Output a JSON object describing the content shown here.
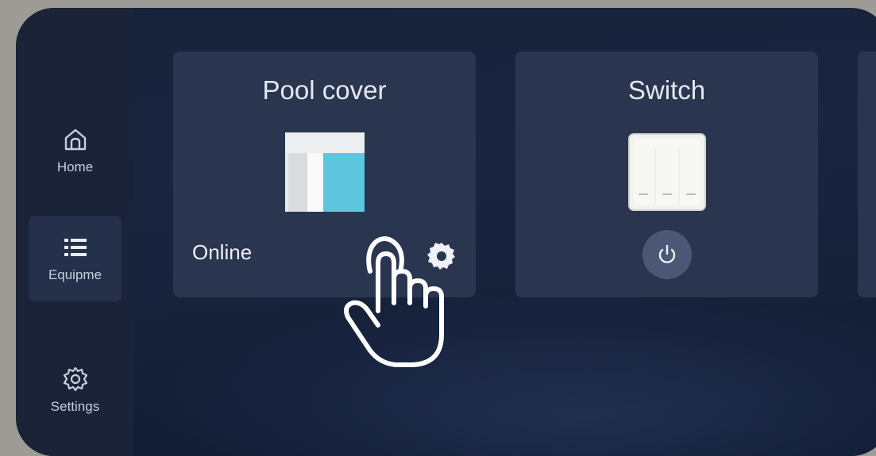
{
  "sidebar": {
    "items": [
      {
        "label": "Home",
        "icon": "home-icon",
        "active": false
      },
      {
        "label": "Equipme",
        "icon": "list-icon",
        "active": true
      },
      {
        "label": "Settings",
        "icon": "gear-icon",
        "active": false
      }
    ]
  },
  "cards": [
    {
      "title": "Pool cover",
      "status": "Online",
      "image": "pool-cover-image",
      "action_icon": "gear-icon"
    },
    {
      "title": "Switch",
      "image": "switch-image",
      "action_icon": "power-icon"
    }
  ],
  "overlay": {
    "icon": "tap-hand-icon"
  },
  "colors": {
    "background": "#17223a",
    "sidebar": "#1a2338",
    "card": "#2a3550",
    "pool_cover_blue": "#5fc7dd",
    "power_button": "#4c5775"
  }
}
